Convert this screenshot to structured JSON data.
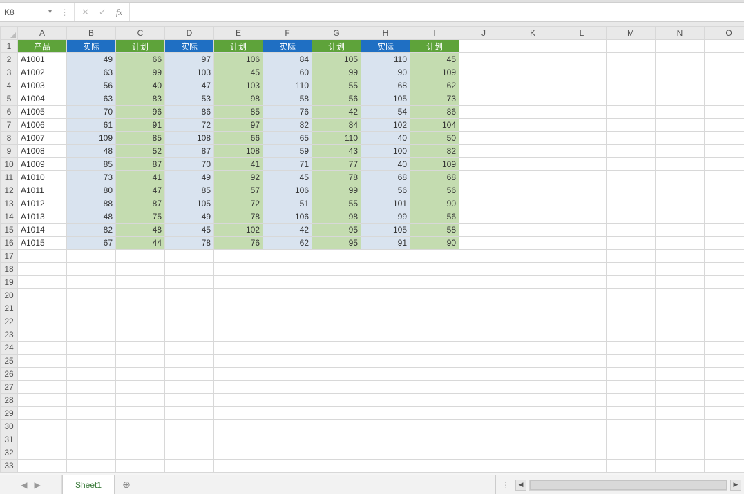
{
  "formula_bar": {
    "cell_ref": "K8",
    "formula": ""
  },
  "columns": [
    "A",
    "B",
    "C",
    "D",
    "E",
    "F",
    "G",
    "H",
    "I",
    "J",
    "K",
    "L",
    "M",
    "N",
    "O"
  ],
  "row_count": 33,
  "headers": {
    "product": "产品",
    "actual": "实际",
    "plan": "计划"
  },
  "data_rows": [
    {
      "prod": "A1001",
      "v": [
        49,
        66,
        97,
        106,
        84,
        105,
        110,
        45
      ]
    },
    {
      "prod": "A1002",
      "v": [
        63,
        99,
        103,
        45,
        60,
        99,
        90,
        109
      ]
    },
    {
      "prod": "A1003",
      "v": [
        56,
        40,
        47,
        103,
        110,
        55,
        68,
        62
      ]
    },
    {
      "prod": "A1004",
      "v": [
        63,
        83,
        53,
        98,
        58,
        56,
        105,
        73
      ]
    },
    {
      "prod": "A1005",
      "v": [
        70,
        96,
        86,
        85,
        76,
        42,
        54,
        86
      ]
    },
    {
      "prod": "A1006",
      "v": [
        61,
        91,
        72,
        97,
        82,
        84,
        102,
        104
      ]
    },
    {
      "prod": "A1007",
      "v": [
        109,
        85,
        108,
        66,
        65,
        110,
        40,
        50
      ]
    },
    {
      "prod": "A1008",
      "v": [
        48,
        52,
        87,
        108,
        59,
        43,
        100,
        82
      ]
    },
    {
      "prod": "A1009",
      "v": [
        85,
        87,
        70,
        41,
        71,
        77,
        40,
        109
      ]
    },
    {
      "prod": "A1010",
      "v": [
        73,
        41,
        49,
        92,
        45,
        78,
        68,
        68
      ]
    },
    {
      "prod": "A1011",
      "v": [
        80,
        47,
        85,
        57,
        106,
        99,
        56,
        56
      ]
    },
    {
      "prod": "A1012",
      "v": [
        88,
        87,
        105,
        72,
        51,
        55,
        101,
        90
      ]
    },
    {
      "prod": "A1013",
      "v": [
        48,
        75,
        49,
        78,
        106,
        98,
        99,
        56
      ]
    },
    {
      "prod": "A1014",
      "v": [
        82,
        48,
        45,
        102,
        42,
        95,
        105,
        58
      ]
    },
    {
      "prod": "A1015",
      "v": [
        67,
        44,
        78,
        76,
        62,
        95,
        91,
        90
      ]
    }
  ],
  "header_styles": [
    "header-green",
    "header-blue",
    "header-green",
    "header-blue",
    "header-green",
    "header-blue",
    "header-green",
    "header-blue",
    "header-green"
  ],
  "sheet_tabs": {
    "active": "Sheet1"
  },
  "icons": {
    "cancel": "✕",
    "confirm": "✓",
    "fx": "fx",
    "dropdown": "▾",
    "nav_left": "◀",
    "nav_right": "▶",
    "add": "⊕",
    "grip": "⋮"
  }
}
